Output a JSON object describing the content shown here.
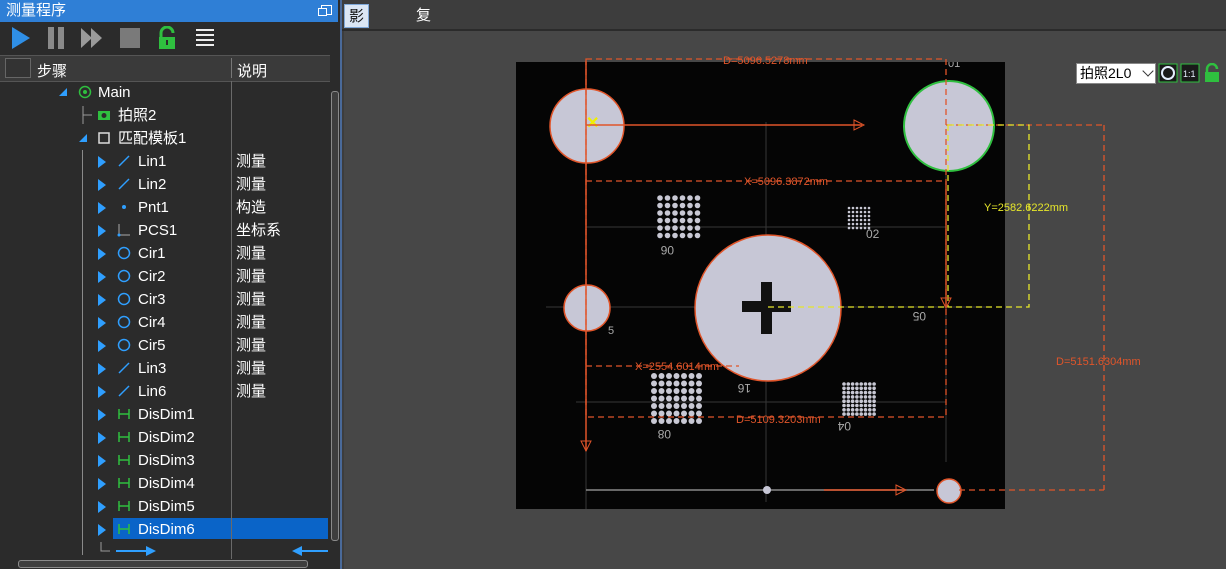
{
  "left_panel": {
    "title": "测量程序",
    "columns": {
      "step": "步骤",
      "desc": "说明"
    },
    "tree": [
      {
        "label": "Main",
        "desc": "",
        "icon": "main-icon",
        "level": 0,
        "expanded": true
      },
      {
        "label": "拍照2",
        "desc": "",
        "icon": "capture-icon",
        "level": 1
      },
      {
        "label": "匹配模板1",
        "desc": "",
        "icon": "template-icon",
        "level": 1,
        "expanded": true
      },
      {
        "label": "Lin1",
        "desc": "测量",
        "icon": "line-icon",
        "level": 2
      },
      {
        "label": "Lin2",
        "desc": "测量",
        "icon": "line-icon",
        "level": 2
      },
      {
        "label": "Pnt1",
        "desc": "构造",
        "icon": "point-icon",
        "level": 2
      },
      {
        "label": "PCS1",
        "desc": "坐标系",
        "icon": "coordinate-icon",
        "level": 2
      },
      {
        "label": "Cir1",
        "desc": "测量",
        "icon": "circle-icon",
        "level": 2
      },
      {
        "label": "Cir2",
        "desc": "测量",
        "icon": "circle-icon",
        "level": 2
      },
      {
        "label": "Cir3",
        "desc": "测量",
        "icon": "circle-icon",
        "level": 2
      },
      {
        "label": "Cir4",
        "desc": "测量",
        "icon": "circle-icon",
        "level": 2
      },
      {
        "label": "Cir5",
        "desc": "测量",
        "icon": "circle-icon",
        "level": 2
      },
      {
        "label": "Lin3",
        "desc": "测量",
        "icon": "line-icon",
        "level": 2
      },
      {
        "label": "Lin6",
        "desc": "测量",
        "icon": "line-icon",
        "level": 2
      },
      {
        "label": "DisDim1",
        "desc": "",
        "icon": "dimension-icon",
        "level": 2
      },
      {
        "label": "DisDim2",
        "desc": "",
        "icon": "dimension-icon",
        "level": 2
      },
      {
        "label": "DisDim3",
        "desc": "",
        "icon": "dimension-icon",
        "level": 2
      },
      {
        "label": "DisDim4",
        "desc": "",
        "icon": "dimension-icon",
        "level": 2
      },
      {
        "label": "DisDim5",
        "desc": "",
        "icon": "dimension-icon",
        "level": 2
      },
      {
        "label": "DisDim6",
        "desc": "",
        "icon": "dimension-icon",
        "level": 2,
        "selected": true
      }
    ]
  },
  "right_panel": {
    "tabs": [
      {
        "label": "影像窗口",
        "active": true
      },
      {
        "label": "复测窗口",
        "active": false
      }
    ],
    "capture_select": "拍照2L0",
    "ratio_label": "1:1",
    "measurements": {
      "d_top": "D=5096.5278mm",
      "x_mid": "X=5096.3872mm",
      "y_right": "Y=2582.6222mm",
      "x_left": "X=2554.6014mm",
      "d_bottom": "D=5109.3203mm",
      "d_right": "D=5151.6304mm"
    },
    "image_labels": [
      "06",
      "02",
      "05",
      "16",
      "08",
      "04",
      "5",
      "01"
    ]
  },
  "colors": {
    "accent": "#2f7fd6",
    "selection": "#0a64c8",
    "measure_orange": "#e0552a",
    "measure_yellow": "#e6e62a",
    "green_ok": "#2fbf3f"
  }
}
